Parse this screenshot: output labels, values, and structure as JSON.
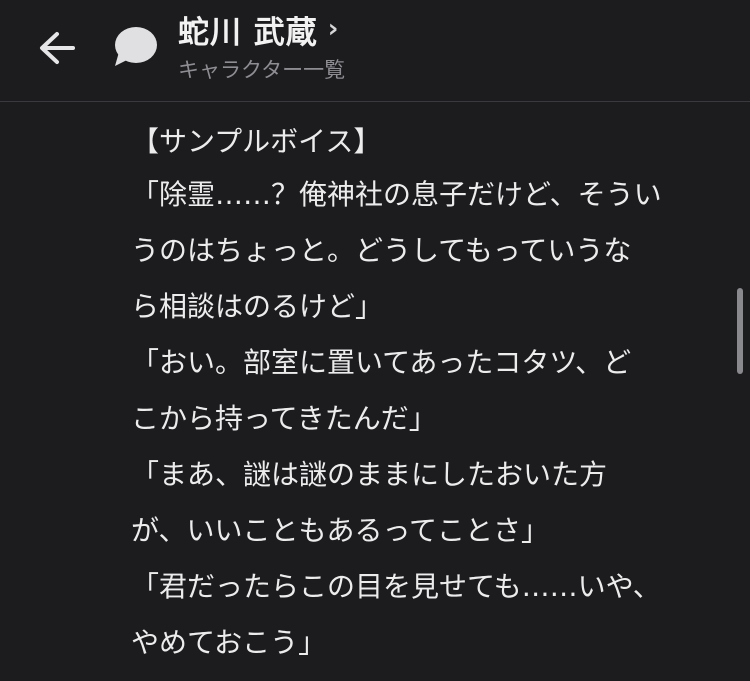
{
  "header": {
    "back_icon": "arrow-left-icon",
    "chat_icon": "speech-bubble-icon",
    "title": "蛇川 武蔵",
    "chevron": "›",
    "subtitle": "キャラクター一覧"
  },
  "content": {
    "heading": "【サンプルボイス】",
    "lines": [
      "「除霊……？俺神社の息子だけど、そうい",
      "うのはちょっと。どうしてもっていうな",
      "ら相談はのるけど」",
      "「おい。部室に置いてあったコタツ、ど",
      "こから持ってきたんだ」",
      "「まあ、謎は謎のままにしたおいた方",
      "が、いいこともあるってことさ」",
      "「君だったらこの目を見せても……いや、",
      "やめておこう」"
    ]
  },
  "colors": {
    "background": "#1c1c1f",
    "text": "#ececed",
    "subtitle": "#8d8d92",
    "divider": "#3a3a3e"
  }
}
